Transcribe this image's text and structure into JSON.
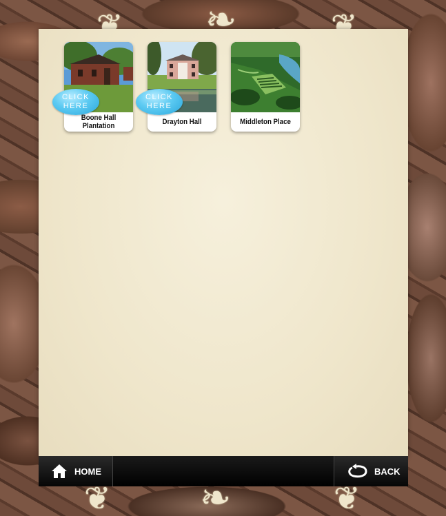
{
  "tiles": [
    {
      "caption": "Boone Hall Plantation",
      "badge": [
        "CLICK",
        "HERE"
      ],
      "image": "brick-slave-cabins-photo"
    },
    {
      "caption": "Drayton Hall",
      "badge": [
        "CLICK",
        "HERE"
      ],
      "image": "plantation-house-pond-photo"
    },
    {
      "caption": "Middleton Place",
      "image": "aerial-terraced-gardens-photo"
    }
  ],
  "footer": {
    "home_label": "HOME",
    "home_icon": "house-icon",
    "back_label": "BACK",
    "back_icon": "back-arrow-icon"
  }
}
